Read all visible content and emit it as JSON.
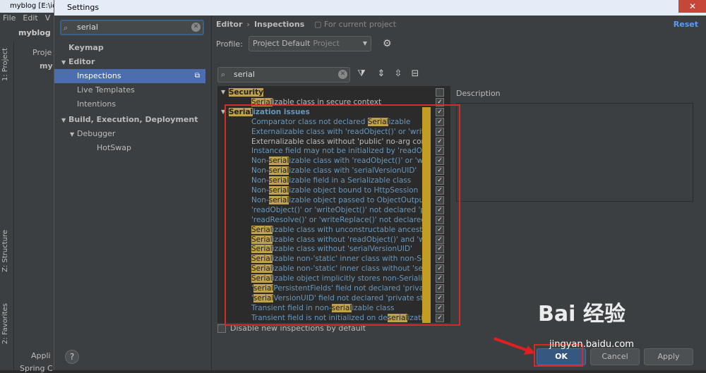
{
  "ide": {
    "title": "myblog [E:\\id",
    "menu": [
      "File",
      "Edit",
      "V"
    ],
    "project_name": "myblog",
    "side_tabs": [
      "1: Project",
      "Z: Structure",
      "2: Favorites"
    ],
    "tree": [
      "Proje",
      "my"
    ],
    "bottom_items": [
      "Appli",
      "Spring C"
    ]
  },
  "dialog": {
    "title": "Settings",
    "close_glyph": "✕",
    "search": {
      "value": "serial"
    },
    "nav": [
      {
        "label": "Keymap",
        "bold": true,
        "indent": 0
      },
      {
        "label": "Editor",
        "bold": true,
        "indent": 0,
        "expanded": true
      },
      {
        "label": "Inspections",
        "indent": 1,
        "selected": true
      },
      {
        "label": "Live Templates",
        "indent": 1
      },
      {
        "label": "Intentions",
        "indent": 1
      },
      {
        "label": "Build, Execution, Deployment",
        "bold": true,
        "indent": 0,
        "expanded": true
      },
      {
        "label": "Debugger",
        "indent": 1,
        "expanded": true
      },
      {
        "label": "HotSwap",
        "indent": 2
      }
    ],
    "breadcrumb": [
      "Editor",
      "Inspections"
    ],
    "scope": "For current project",
    "reset": "Reset",
    "profile_label": "Profile:",
    "profile_value": "Project Default",
    "profile_scope": "Project",
    "insp_search": {
      "value": "serial"
    },
    "description_label": "Description",
    "disable_new": "Disable new inspections by default",
    "help": "?",
    "buttons": {
      "ok": "OK",
      "cancel": "Cancel",
      "apply": "Apply"
    }
  },
  "inspections": [
    {
      "group": true,
      "parts": [
        "",
        "Security",
        ""
      ],
      "blue": false
    },
    {
      "parts": [
        "",
        "Serial",
        "izable class in secure context"
      ],
      "plain": true
    },
    {
      "group": true,
      "parts": [
        "",
        "Serial",
        "ization issues"
      ],
      "blue": true
    },
    {
      "parts": [
        "Comparator class not declared ",
        "Serial",
        "izable"
      ]
    },
    {
      "parts": [
        "Externalizable class with 'readObject()' or 'writeC",
        "",
        ""
      ]
    },
    {
      "parts": [
        "Externalizable class without 'public' no-arg cons",
        "",
        ""
      ],
      "plain": true
    },
    {
      "parts": [
        "Instance field may not be initialized by 'readObje",
        "",
        ""
      ]
    },
    {
      "parts": [
        "Non-",
        "serial",
        "izable class with 'readObject()' or 'writ"
      ]
    },
    {
      "parts": [
        "Non-",
        "serial",
        "izable class with 'serialVersionUID'"
      ]
    },
    {
      "parts": [
        "Non-",
        "serial",
        "izable field in a Serializable class"
      ]
    },
    {
      "parts": [
        "Non-",
        "serial",
        "izable object bound to HttpSession"
      ]
    },
    {
      "parts": [
        "Non-",
        "serial",
        "izable object passed to ObjectOutputS"
      ]
    },
    {
      "parts": [
        "'readObject()' or 'writeObject()' not declared 'pri",
        "",
        ""
      ]
    },
    {
      "parts": [
        "'readResolve()' or 'writeReplace()' not declared 'p",
        "",
        ""
      ]
    },
    {
      "parts": [
        "",
        "Serial",
        "izable class with unconstructable ancestor"
      ]
    },
    {
      "parts": [
        "",
        "Serial",
        "izable class without 'readObject()' and 'writ"
      ]
    },
    {
      "parts": [
        "",
        "Serial",
        "izable class without 'serialVersionUID'"
      ]
    },
    {
      "parts": [
        "",
        "Serial",
        "izable non-'static' inner class with non-Ser"
      ]
    },
    {
      "parts": [
        "",
        "Serial",
        "izable non-'static' inner class without 'seria"
      ]
    },
    {
      "parts": [
        "",
        "Serial",
        "izable object implicitly stores non-Serializa"
      ]
    },
    {
      "parts": [
        "'",
        "serial",
        "PersistentFields' field not declared 'private"
      ]
    },
    {
      "parts": [
        "'",
        "serial",
        "VersionUID' field not declared 'private stati"
      ]
    },
    {
      "parts": [
        "Transient field in non-",
        "serial",
        "izable class"
      ]
    },
    {
      "parts": [
        "Transient field is not initialized on de",
        "serial",
        "ization"
      ]
    }
  ],
  "watermark": {
    "brand": "Bai 经验",
    "url": "jingyan.baidu.com"
  }
}
